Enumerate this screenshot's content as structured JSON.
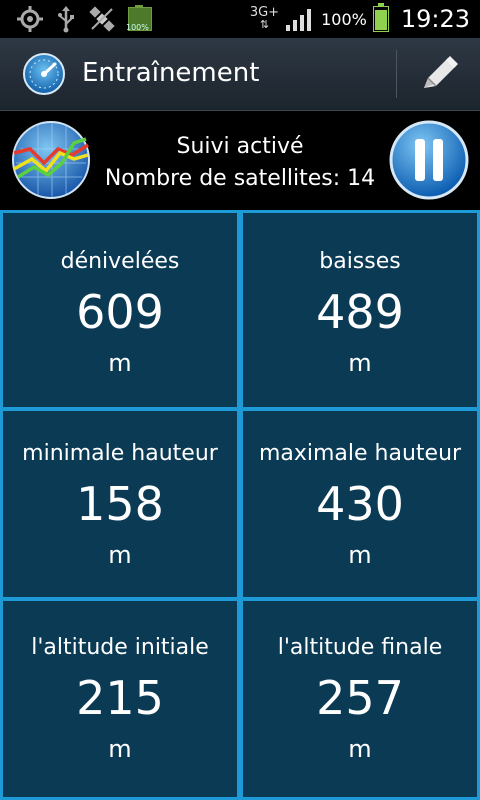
{
  "status_bar": {
    "left_icons": [
      "gps-icon",
      "usb-icon",
      "satellite-off-icon",
      "battery-small-icon"
    ],
    "battery_small_label": "100%",
    "network": "3G+",
    "battery_percent": "100%",
    "time": "19:23"
  },
  "action_bar": {
    "title": "Entraînement",
    "app_icon": "speedometer-icon",
    "edit_icon": "pencil-icon"
  },
  "tracking": {
    "status": "Suivi activé",
    "satellites": "Nombre de satellites: 14",
    "chart_icon": "chart-globe-icon",
    "pause_icon": "pause-icon"
  },
  "stats": [
    {
      "label": "dénivelées",
      "value": "609",
      "unit": "m"
    },
    {
      "label": "baisses",
      "value": "489",
      "unit": "m"
    },
    {
      "label": "minimale hauteur",
      "value": "158",
      "unit": "m"
    },
    {
      "label": "maximale hauteur",
      "value": "430",
      "unit": "m"
    },
    {
      "label": "l'altitude initiale",
      "value": "215",
      "unit": "m"
    },
    {
      "label": "l'altitude finale",
      "value": "257",
      "unit": "m"
    }
  ],
  "colors": {
    "grid_border": "#1e9ad6",
    "cell_bg": "#0b3a55",
    "battery": "#8fd14f"
  }
}
